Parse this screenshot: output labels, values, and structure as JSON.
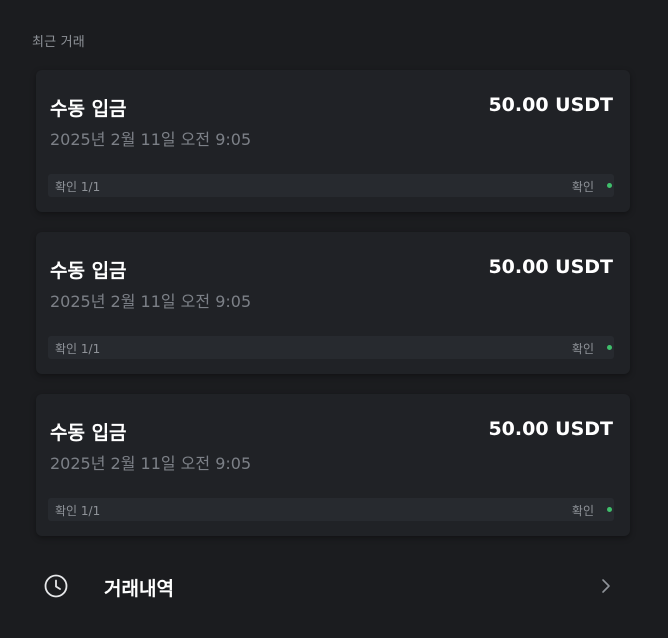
{
  "section": {
    "title": "최근 거래"
  },
  "transactions": [
    {
      "type": "수동 입금",
      "amount": "50.00 USDT",
      "date": "2025년 2월 11일 오전 9:05",
      "confirmations": "확인 1/1",
      "status": "확인",
      "status_color": "#3fbf6b"
    },
    {
      "type": "수동 입금",
      "amount": "50.00 USDT",
      "date": "2025년 2월 11일 오전 9:05",
      "confirmations": "확인 1/1",
      "status": "확인",
      "status_color": "#3fbf6b"
    },
    {
      "type": "수동 입금",
      "amount": "50.00 USDT",
      "date": "2025년 2월 11일 오전 9:05",
      "confirmations": "확인 1/1",
      "status": "확인",
      "status_color": "#3fbf6b"
    }
  ],
  "history": {
    "label": "거래내역",
    "icon": "clock-icon",
    "chevron_icon": "chevron-right-icon"
  },
  "colors": {
    "background": "#1b1c1f",
    "card": "#202226",
    "muted_text": "#7c8087",
    "accent_green": "#3fbf6b"
  }
}
